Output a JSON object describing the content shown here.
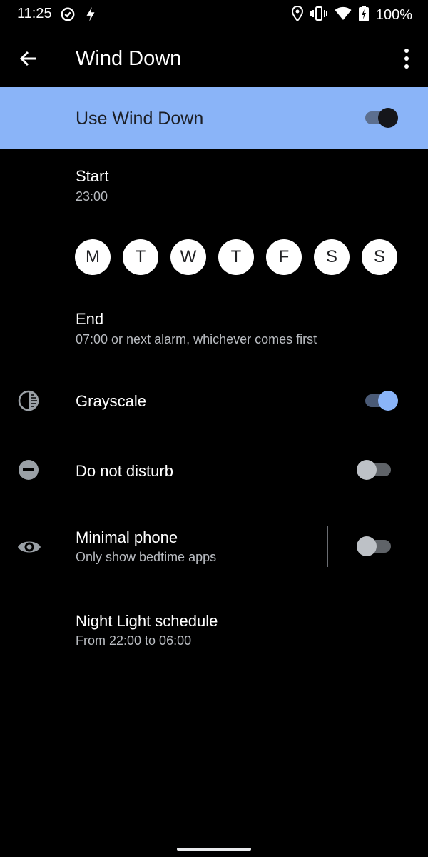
{
  "status_bar": {
    "time": "11:25",
    "battery": "100%",
    "icons": [
      "data-saver-icon",
      "bolt-icon",
      "location-icon",
      "vibrate-icon",
      "wifi-icon",
      "battery-charging-icon"
    ]
  },
  "app_bar": {
    "title": "Wind Down",
    "back_icon": "arrow-back-icon",
    "overflow_icon": "more-vert-icon"
  },
  "master_toggle": {
    "label": "Use Wind Down",
    "enabled": true
  },
  "schedule": {
    "start": {
      "title": "Start",
      "value": "23:00"
    },
    "days": [
      "M",
      "T",
      "W",
      "T",
      "F",
      "S",
      "S"
    ],
    "end": {
      "title": "End",
      "value": "07:00 or next alarm, whichever comes first"
    }
  },
  "options": {
    "grayscale": {
      "label": "Grayscale",
      "icon": "grayscale-icon",
      "enabled": true
    },
    "dnd": {
      "label": "Do not disturb",
      "icon": "do-not-disturb-icon",
      "enabled": false
    },
    "minimal_phone": {
      "label": "Minimal phone",
      "summary": "Only show bedtime apps",
      "icon": "eye-icon",
      "enabled": false
    }
  },
  "night_light": {
    "title": "Night Light schedule",
    "summary": "From 22:00 to 06:00",
    "icon": "moon-icon"
  },
  "colors": {
    "accent": "#8ab4f8",
    "background": "#000000",
    "secondary_text": "#b9bcc1"
  }
}
